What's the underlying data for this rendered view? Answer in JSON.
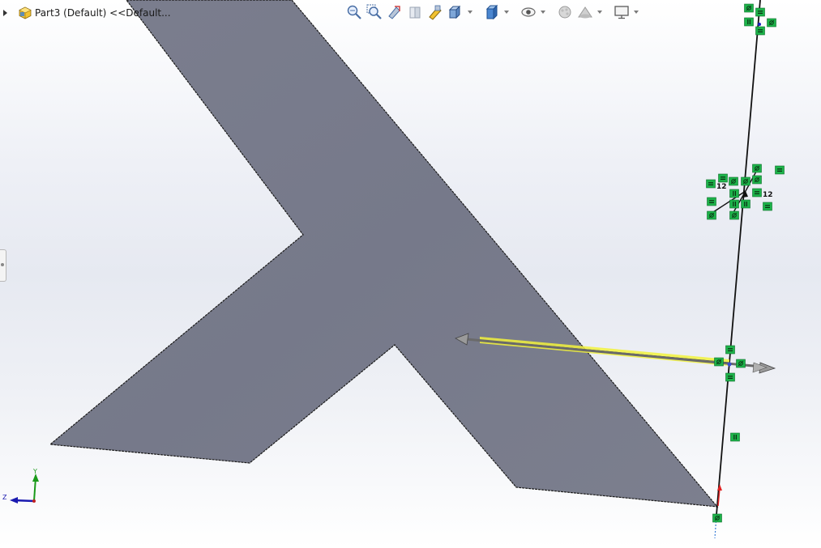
{
  "document": {
    "title": "Part3 (Default) <<Default..."
  },
  "toolbar": {
    "buttons": [
      {
        "icon": "zoom-to-fit-icon"
      },
      {
        "icon": "zoom-to-area-icon"
      },
      {
        "icon": "previous-view-icon"
      },
      {
        "icon": "section-view-icon"
      },
      {
        "icon": "dynamic-annotation-views-icon"
      },
      {
        "icon": "view-orientation-icon",
        "dropdown": true
      },
      {
        "icon": "display-style-icon",
        "dropdown": true
      },
      {
        "icon": "hide-show-items-icon",
        "dropdown": true
      },
      {
        "icon": "edit-appearance-icon"
      },
      {
        "icon": "apply-scene-icon",
        "dropdown": true
      },
      {
        "icon": "view-settings-icon",
        "dropdown": true
      }
    ]
  },
  "triad": {
    "x_axis": "x",
    "y_axis": "Y",
    "z_axis": "Z"
  },
  "sketch": {
    "dimension_labels": [
      "12",
      "12"
    ]
  },
  "colors": {
    "part_face": "#7a7d8d",
    "relation_badge": "#1db34a",
    "selected_edge": "#f2f23c",
    "background_top": "#ffffff",
    "background_mid": "#e6e9f1"
  }
}
